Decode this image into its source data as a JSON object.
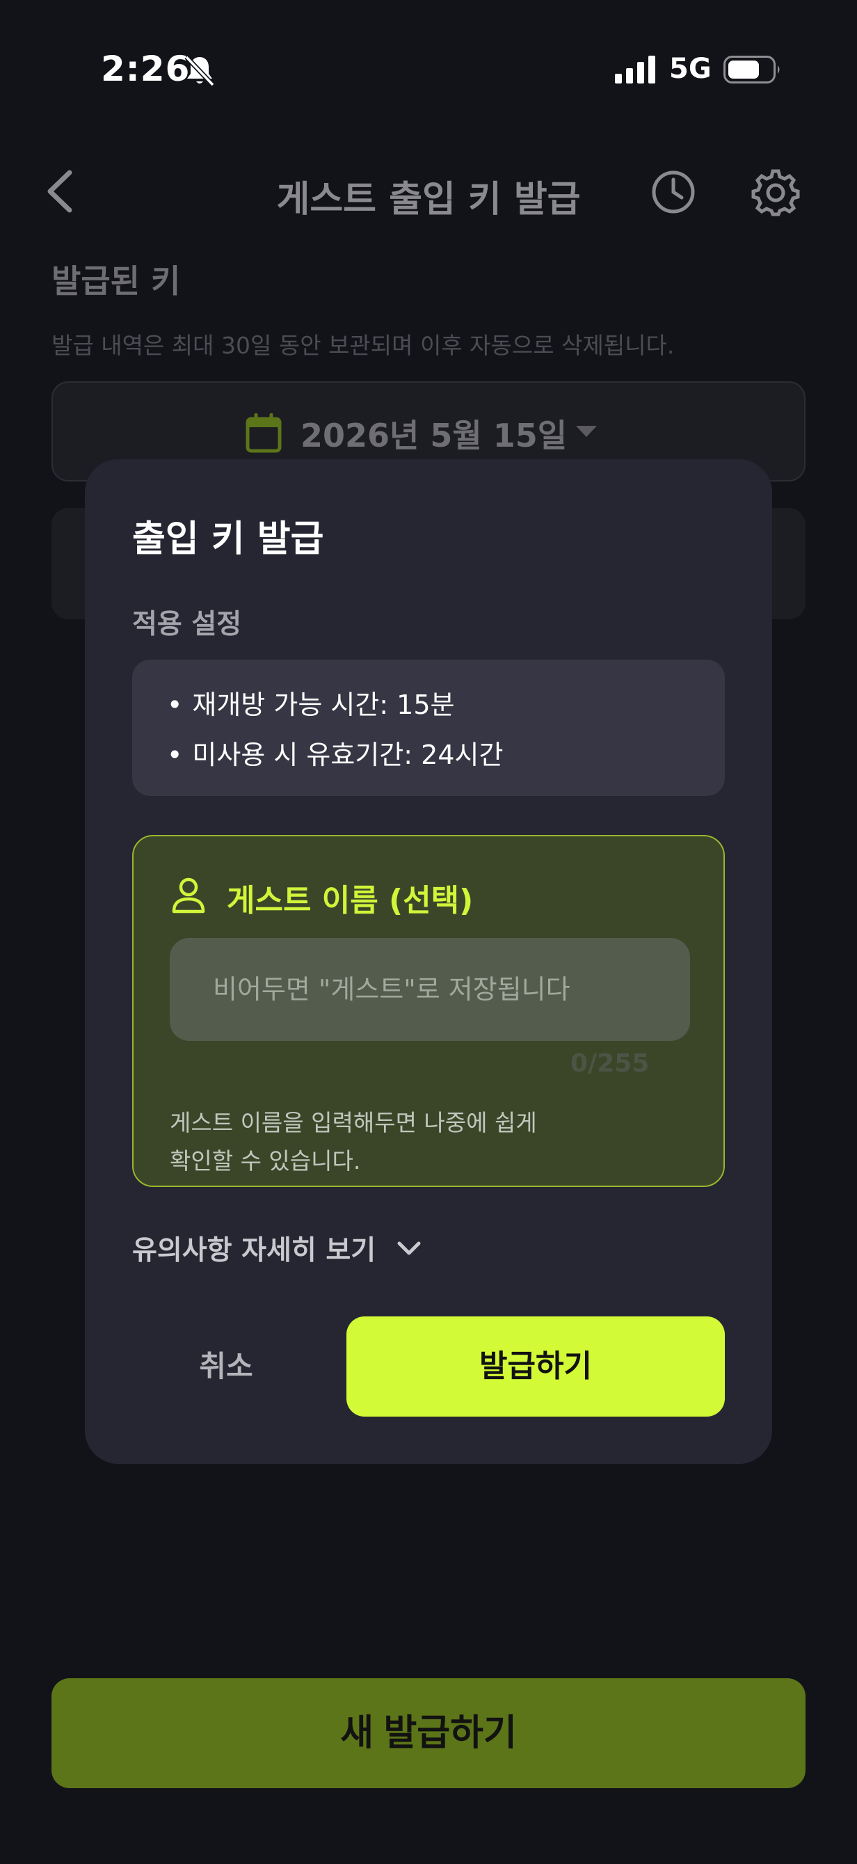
{
  "status_bar": {
    "time": "2:26",
    "network": "5G",
    "icons": [
      "bell-slash-icon",
      "signal-icon",
      "battery-icon"
    ]
  },
  "header": {
    "title": "게스트 출입 키 발급",
    "icons": [
      "back-icon",
      "history-icon",
      "settings-icon"
    ]
  },
  "issued_keys": {
    "title": "발급된 키",
    "description": "발급 내역은 최대 30일 동안 보관되며 이후 자동으로 삭제됩니다.",
    "date": "2026년 5월 15일"
  },
  "footer": {
    "new_issue_label": "새 발급하기"
  },
  "modal": {
    "title": "출입 키 발급",
    "settings_label": "적용 설정",
    "settings_lines": [
      "재개방 가능 시간: 15분",
      "미사용 시 유효기간: 24시간"
    ],
    "guest_name": {
      "title": "게스트 이름 (선택)",
      "placeholder": "비어두면 \"게스트\"로 저장됩니다",
      "value": "",
      "char_count": "0/255",
      "help": "게스트 이름을 입력해두면 나중에 쉽게 확인할 수 있습니다."
    },
    "notice_toggle_label": "유의사항 자세히 보기",
    "cancel_label": "취소",
    "issue_label": "발급하기"
  },
  "colors": {
    "background": "#121219",
    "modal": "#262632",
    "accent": "#d2fa37",
    "accent_dim": "#5c7519",
    "panel_green": "#3b4629"
  }
}
